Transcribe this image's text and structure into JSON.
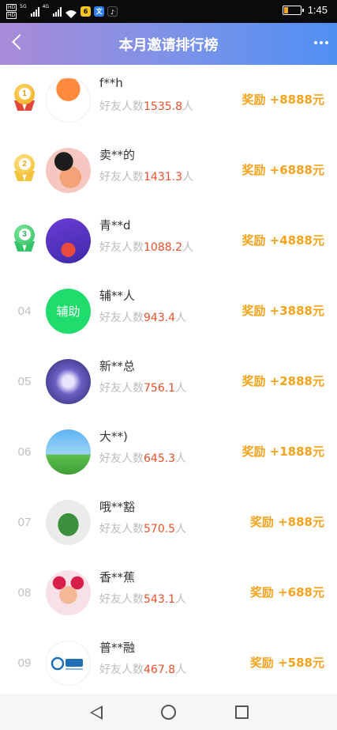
{
  "status_bar": {
    "time": "1:45",
    "sim1": "HD",
    "sim2": "HD",
    "net1": "5G",
    "net2": "4G",
    "icons": [
      "hd-icon",
      "signal-icon",
      "wifi-icon",
      "app-icon",
      "chat-icon",
      "tiktok-icon",
      "battery-icon"
    ]
  },
  "header": {
    "title": "本月邀请排行榜",
    "back_icon": "chevron-left-icon",
    "more_icon": "more-dots-icon"
  },
  "friends_label": "好友人数",
  "friends_unit": "人",
  "rows": [
    {
      "rank": "1",
      "medal": "gold",
      "name": "f**h",
      "count": "1535.8",
      "reward": "奖励 +8888元",
      "avatar": "phone-app-avatar"
    },
    {
      "rank": "2",
      "medal": "yellow",
      "name": "卖**的",
      "count": "1431.3",
      "reward": "奖励 +6888元",
      "avatar": "person-avatar"
    },
    {
      "rank": "3",
      "medal": "green",
      "name": "青**d",
      "count": "1088.2",
      "reward": "奖励 +4888元",
      "avatar": "promo-avatar"
    },
    {
      "rank": "04",
      "medal": "",
      "name": "辅**人",
      "count": "943.4",
      "reward": "奖励 +3888元",
      "avatar": "text-avatar",
      "avatar_text": "辅助"
    },
    {
      "rank": "05",
      "medal": "",
      "name": "新**总",
      "count": "756.1",
      "reward": "奖励 +2888元",
      "avatar": "calligraphy-avatar"
    },
    {
      "rank": "06",
      "medal": "",
      "name": "大**)",
      "count": "645.3",
      "reward": "奖励 +1888元",
      "avatar": "sky-avatar"
    },
    {
      "rank": "07",
      "medal": "",
      "name": "哦**豁",
      "count": "570.5",
      "reward": "奖励 +888元",
      "avatar": "cabbage-avatar"
    },
    {
      "rank": "08",
      "medal": "",
      "name": "香**蕉",
      "count": "543.1",
      "reward": "奖励 +688元",
      "avatar": "child-avatar"
    },
    {
      "rank": "09",
      "medal": "",
      "name": "普**融",
      "count": "467.8",
      "reward": "奖励 +588元",
      "avatar": "logo-avatar"
    }
  ],
  "nav_bar": {
    "icons": [
      "nav-back-icon",
      "nav-home-icon",
      "nav-recent-icon"
    ]
  },
  "colors": {
    "header_gradient": [
      "#a98bd8",
      "#4f8ff3"
    ],
    "reward": "#f5a31c",
    "count": "#e4502a",
    "muted": "#bcbcbc",
    "gold": "#f0b429",
    "green": "#3cc46a"
  }
}
